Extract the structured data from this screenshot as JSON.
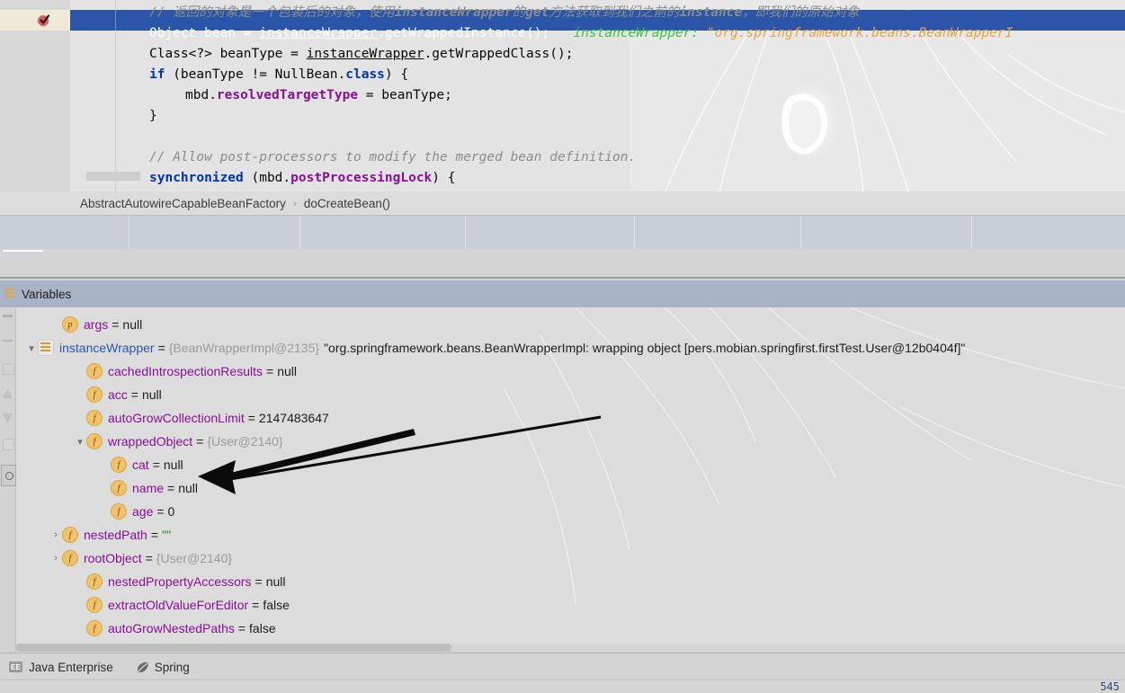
{
  "editor": {
    "breakpoint_icon": "breakpoint-verified-icon",
    "lines": [
      {
        "indent": 0,
        "selected": false,
        "tokens": [
          {
            "cls": "cmt",
            "t": "// 返回的对象是一个包装后的对象，使用"
          },
          {
            "cls": "cmt-b",
            "t": "instanceWrapper"
          },
          {
            "cls": "cmt",
            "t": "的"
          },
          {
            "cls": "cmt-b",
            "t": "get"
          },
          {
            "cls": "cmt",
            "t": "方法获取到我们之前的"
          },
          {
            "cls": "cmt-b",
            "t": "instance"
          },
          {
            "cls": "cmt",
            "t": "，即我们的原始对象"
          }
        ]
      },
      {
        "indent": 0,
        "selected": true,
        "tokens": [
          {
            "cls": "cls",
            "t": "Object"
          },
          {
            "cls": "plain",
            "t": " bean = "
          },
          {
            "cls": "und",
            "t": "instanceWrapper"
          },
          {
            "cls": "plain",
            "t": ".getWrappedInstance();"
          },
          {
            "cls": "hint-name",
            "t": "   instanceWrapper:"
          },
          {
            "cls": "hint-val",
            "t": " \"org.springframework.beans.BeanWrapperI"
          }
        ]
      },
      {
        "indent": 0,
        "selected": false,
        "tokens": [
          {
            "cls": "cls",
            "t": "Class<?>"
          },
          {
            "cls": "plain",
            "t": " beanType = "
          },
          {
            "cls": "und",
            "t": "instanceWrapper"
          },
          {
            "cls": "plain",
            "t": ".getWrappedClass();"
          }
        ]
      },
      {
        "indent": 0,
        "selected": false,
        "tokens": [
          {
            "cls": "kw",
            "t": "if"
          },
          {
            "cls": "plain",
            "t": " (beanType != NullBean."
          },
          {
            "cls": "kw",
            "t": "class"
          },
          {
            "cls": "plain",
            "t": ") {"
          }
        ]
      },
      {
        "indent": 1,
        "selected": false,
        "tokens": [
          {
            "cls": "plain",
            "t": "mbd."
          },
          {
            "cls": "fld",
            "t": "resolvedTargetType"
          },
          {
            "cls": "plain",
            "t": " = beanType;"
          }
        ]
      },
      {
        "indent": 0,
        "selected": false,
        "tokens": [
          {
            "cls": "plain",
            "t": "}"
          }
        ]
      },
      {
        "indent": 0,
        "selected": false,
        "tokens": []
      },
      {
        "indent": 0,
        "selected": false,
        "tokens": [
          {
            "cls": "cmt",
            "t": "// Allow post-processors to modify the merged bean definition."
          }
        ]
      },
      {
        "indent": 0,
        "selected": false,
        "tokens": [
          {
            "cls": "kw",
            "t": "synchronized"
          },
          {
            "cls": "plain",
            "t": " (mbd."
          },
          {
            "cls": "fld",
            "t": "postProcessingLock"
          },
          {
            "cls": "plain",
            "t": ") {"
          }
        ]
      }
    ]
  },
  "breadcrumb": {
    "class": "AbstractAutowireCapableBeanFactory",
    "separator": "›",
    "method": "doCreateBean()"
  },
  "debug": {
    "tab_label": "Variables",
    "rows": [
      {
        "indent": 1,
        "twisty": "",
        "icon": "p",
        "name": "args",
        "name_color": "purple",
        "eq": "=",
        "value": "null",
        "value_color": "dark"
      },
      {
        "indent": 0,
        "twisty": "▾",
        "icon": "stack",
        "name": "instanceWrapper",
        "name_color": "blue",
        "eq": "=",
        "value": "{BeanWrapperImpl@2135}",
        "value_color": "gray",
        "value2": "\"org.springframework.beans.BeanWrapperImpl: wrapping object [pers.mobian.springfirst.firstTest.User@12b0404f]\"",
        "value2_color": "dark"
      },
      {
        "indent": 2,
        "twisty": "",
        "icon": "f",
        "name": "cachedIntrospectionResults",
        "name_color": "purple",
        "eq": "=",
        "value": "null",
        "value_color": "dark"
      },
      {
        "indent": 2,
        "twisty": "",
        "icon": "f",
        "name": "acc",
        "name_color": "purple",
        "eq": "=",
        "value": "null",
        "value_color": "dark"
      },
      {
        "indent": 2,
        "twisty": "",
        "icon": "f",
        "name": "autoGrowCollectionLimit",
        "name_color": "purple",
        "eq": "=",
        "value": "2147483647",
        "value_color": "dark"
      },
      {
        "indent": 2,
        "twisty": "▾",
        "icon": "f",
        "name": "wrappedObject",
        "name_color": "purple",
        "eq": "=",
        "value": "{User@2140}",
        "value_color": "gray"
      },
      {
        "indent": 3,
        "twisty": "",
        "icon": "f",
        "name": "cat",
        "name_color": "purple",
        "eq": "=",
        "value": "null",
        "value_color": "dark"
      },
      {
        "indent": 3,
        "twisty": "",
        "icon": "f",
        "name": "name",
        "name_color": "purple",
        "eq": "=",
        "value": "null",
        "value_color": "dark"
      },
      {
        "indent": 3,
        "twisty": "",
        "icon": "f",
        "name": "age",
        "name_color": "purple",
        "eq": "=",
        "value": "0",
        "value_color": "dark"
      },
      {
        "indent": 1,
        "twisty": "›",
        "icon": "f",
        "name": "nestedPath",
        "name_color": "purple",
        "eq": "=",
        "value": "\"\"",
        "value_color": "green"
      },
      {
        "indent": 1,
        "twisty": "›",
        "icon": "f",
        "name": "rootObject",
        "name_color": "purple",
        "eq": "=",
        "value": "{User@2140}",
        "value_color": "gray"
      },
      {
        "indent": 2,
        "twisty": "",
        "icon": "f",
        "name": "nestedPropertyAccessors",
        "name_color": "purple",
        "eq": "=",
        "value": "null",
        "value_color": "dark"
      },
      {
        "indent": 2,
        "twisty": "",
        "icon": "f",
        "name": "extractOldValueForEditor",
        "name_color": "purple",
        "eq": "=",
        "value": "false",
        "value_color": "dark"
      },
      {
        "indent": 2,
        "twisty": "",
        "icon": "f",
        "name": "autoGrowNestedPaths",
        "name_color": "purple",
        "eq": "=",
        "value": "false",
        "value_color": "dark"
      }
    ]
  },
  "status": {
    "items": [
      {
        "icon": "java-enterprise-icon",
        "icon_text": "EE",
        "label": "Java Enterprise"
      },
      {
        "icon": "spring-leaf-icon",
        "icon_text": "",
        "label": "Spring"
      }
    ],
    "corner_number": "545"
  },
  "colors": {
    "selection_blue": "#2a55a8",
    "breakpoint_red": "#db5c5c",
    "hint_green": "#3cc63c",
    "hint_orange": "#e8a33d",
    "keyword_blue": "#0033b3",
    "field_purple": "#871094",
    "var_name_purple": "#871094",
    "panel_header": "#a9b3c6"
  }
}
